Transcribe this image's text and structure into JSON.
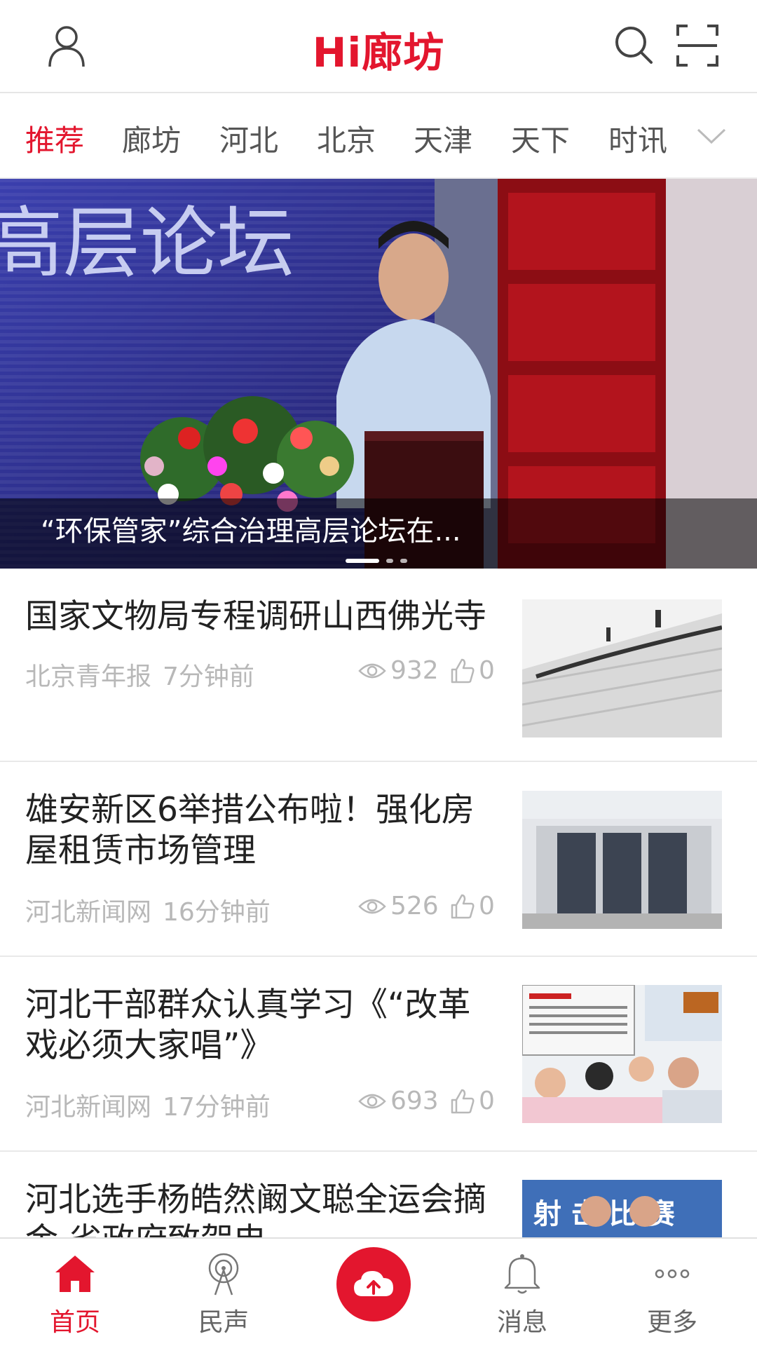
{
  "header": {
    "title": "Hi廊坊",
    "icons": [
      "user-icon",
      "search-icon",
      "scan-icon"
    ]
  },
  "tabs": [
    {
      "label": "推荐",
      "active": true
    },
    {
      "label": "廊坊",
      "active": false
    },
    {
      "label": "河北",
      "active": false
    },
    {
      "label": "北京",
      "active": false
    },
    {
      "label": "天津",
      "active": false
    },
    {
      "label": "天下",
      "active": false
    },
    {
      "label": "时讯",
      "active": false
    }
  ],
  "banner": {
    "caption": "“环保管家”综合治理高层论坛在...",
    "backdrop_text": "高层论坛",
    "slide_count": 3,
    "active_slide": 1
  },
  "news": [
    {
      "title": "国家文物局专程调研山西佛光寺",
      "source": "北京青年报",
      "time": "7分钟前",
      "views": "932",
      "likes": "0"
    },
    {
      "title": "雄安新区6举措公布啦！强化房屋租赁市场管理",
      "source": "河北新闻网",
      "time": "16分钟前",
      "views": "526",
      "likes": "0"
    },
    {
      "title": "河北干部群众认真学习《“改革戏必须大家唱”》",
      "source": "河北新闻网",
      "time": "17分钟前",
      "views": "693",
      "likes": "0"
    },
    {
      "title": "河北选手杨皓然阚文聪全运会摘金 省政府致贺电",
      "thumb_text": "射 击 比 赛"
    }
  ],
  "bottom_nav": [
    {
      "label": "首页",
      "icon": "home-icon",
      "active": true
    },
    {
      "label": "民声",
      "icon": "broadcast-icon",
      "active": false
    },
    {
      "label": "",
      "icon": "cloud-upload-icon",
      "active": false
    },
    {
      "label": "消息",
      "icon": "bell-icon",
      "active": false
    },
    {
      "label": "更多",
      "icon": "more-icon",
      "active": false
    }
  ],
  "colors": {
    "brand_red": "#e3162e",
    "meta_gray": "#b8b8b8",
    "tab_gray": "#555555"
  }
}
